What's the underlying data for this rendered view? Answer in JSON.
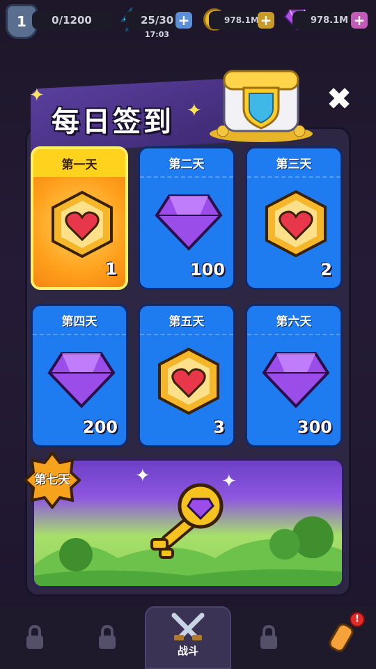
{
  "topbar": {
    "level": "1",
    "xp": "0/1200",
    "energy": "25/30",
    "energy_timer": "17:03",
    "coins": "978.1M",
    "gems": "978.1M",
    "plus": "+"
  },
  "popup": {
    "title": "每日签到",
    "close": "✖"
  },
  "days": [
    {
      "label": "第一天",
      "reward": "heart-medal",
      "amount": "1"
    },
    {
      "label": "第二天",
      "reward": "gem",
      "amount": "100"
    },
    {
      "label": "第三天",
      "reward": "heart-medal",
      "amount": "2"
    },
    {
      "label": "第四天",
      "reward": "gem",
      "amount": "200"
    },
    {
      "label": "第五天",
      "reward": "heart-medal",
      "amount": "3"
    },
    {
      "label": "第六天",
      "reward": "gem",
      "amount": "300"
    }
  ],
  "day7": {
    "label": "第七天",
    "reward": "golden-key"
  },
  "bottom_nav": {
    "battle_label": "战斗",
    "badge": "!"
  },
  "colors": {
    "card_blue": "#1e7cf0",
    "card_active": "#ff9f1c",
    "gem_purple": "#9b4dea"
  }
}
